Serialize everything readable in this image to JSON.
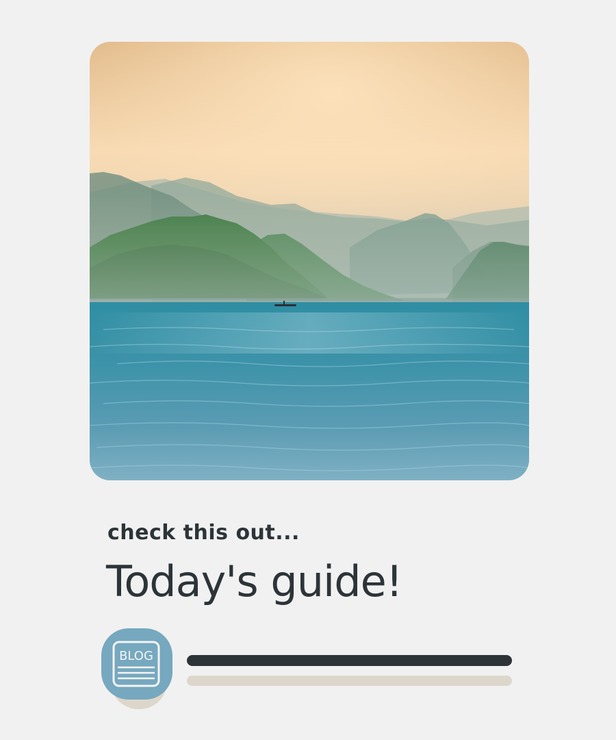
{
  "kicker": "check this out...",
  "headline": "Today's guide!",
  "badge": {
    "icon": "blog-document-icon",
    "label": "BLOG"
  },
  "hero_image": {
    "subject": "misty mountains over a calm blue lake with a small boat"
  },
  "colors": {
    "background": "#f1f1f1",
    "text": "#2c3438",
    "badge": "#76a8bf",
    "accent_light": "#ddd7cb"
  }
}
